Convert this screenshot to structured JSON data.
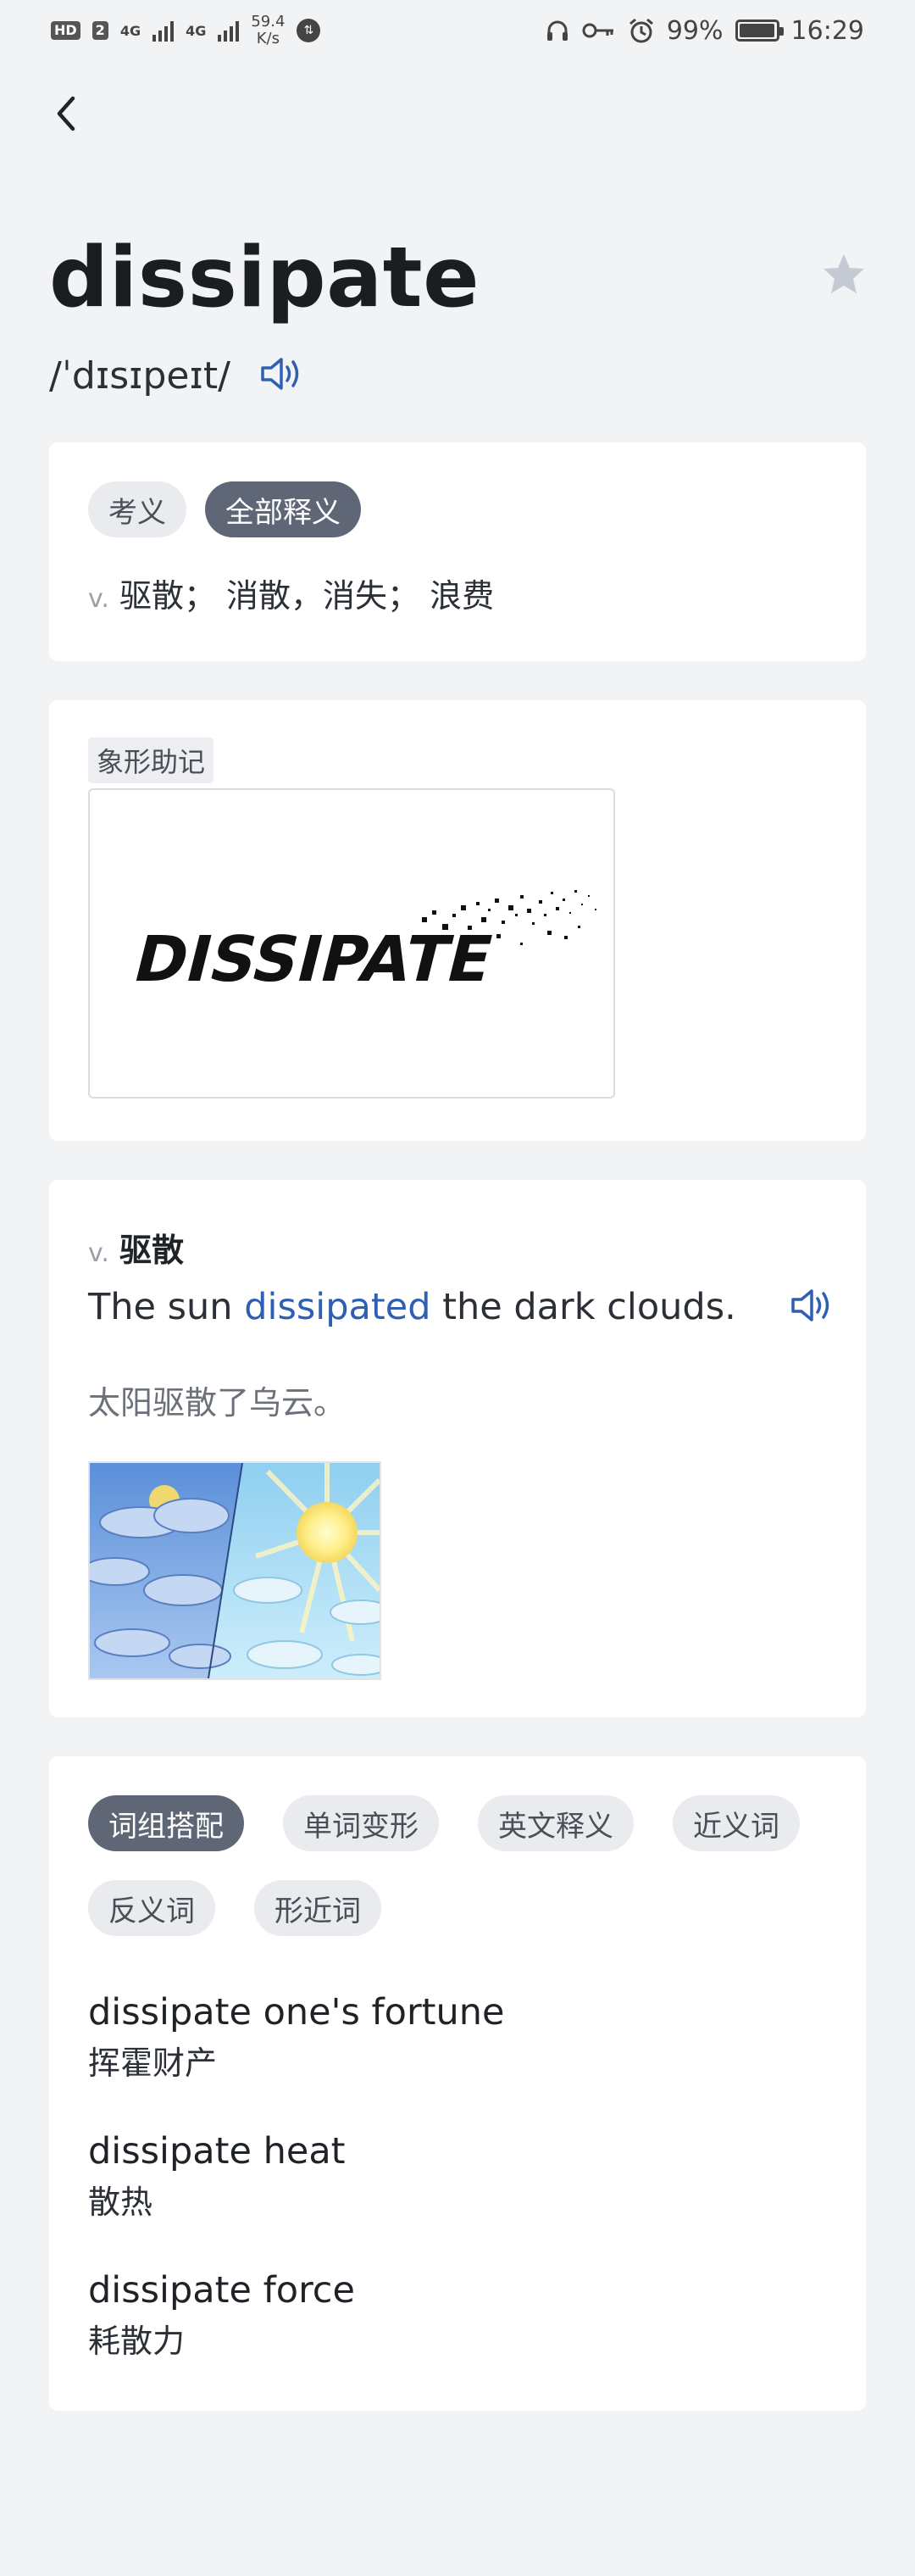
{
  "status_bar": {
    "hd": "HD",
    "sim": "2",
    "net1": "4G",
    "net2": "4G",
    "speed_value": "59.4",
    "speed_unit": "K/s",
    "battery": "99%",
    "battery_level": 0.99,
    "time": "16:29"
  },
  "word": {
    "headword": "dissipate",
    "phonetic": "/ˈdɪsɪpeɪt/"
  },
  "definition_card": {
    "tabs": [
      {
        "label": "考义",
        "active": false
      },
      {
        "label": "全部释义",
        "active": true
      }
    ],
    "pos": "v.",
    "meaning": "驱散； 消散，消失； 浪费"
  },
  "mnemonic_card": {
    "tag": "象形助记",
    "image_text": "DISSIPATE"
  },
  "example_card": {
    "pos": "v.",
    "sense": "驱散",
    "sentence_before": "The sun ",
    "sentence_highlight": "dissipated",
    "sentence_after": " the dark clouds.",
    "translation": "太阳驱散了乌云。"
  },
  "phrase_card": {
    "tabs": [
      {
        "label": "词组搭配",
        "active": true
      },
      {
        "label": "单词变形",
        "active": false
      },
      {
        "label": "英文释义",
        "active": false
      },
      {
        "label": "近义词",
        "active": false
      },
      {
        "label": "反义词",
        "active": false
      },
      {
        "label": "形近词",
        "active": false
      }
    ],
    "phrases": [
      {
        "en": "dissipate one's fortune",
        "cn": "挥霍财产"
      },
      {
        "en": "dissipate heat",
        "cn": "散热"
      },
      {
        "en": "dissipate force",
        "cn": "耗散力"
      }
    ]
  },
  "colors": {
    "background": "#f2f3f5",
    "card": "#ffffff",
    "accent_blue": "#2f5fb3",
    "chip_active": "#5f6676",
    "chip_inactive": "#e9ebef",
    "star": "#c5cbd3"
  },
  "icons": {
    "back": "chevron-left-icon",
    "favorite": "star-icon",
    "audio": "speaker-icon"
  }
}
